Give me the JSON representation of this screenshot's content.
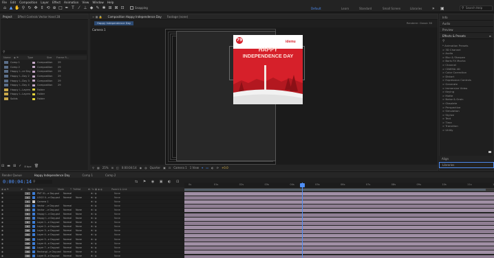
{
  "menu": [
    "File",
    "Edit",
    "Composition",
    "Layer",
    "Effect",
    "Animation",
    "View",
    "Window",
    "Help"
  ],
  "toolbar": {
    "snapping_label": "Snapping",
    "workspaces": [
      "Default",
      "Learn",
      "Standard",
      "Small Screen",
      "Libraries"
    ],
    "search_help": "Search Help"
  },
  "project_panel": {
    "tabs": [
      "Project",
      "Effect Controls  Vector Hand 28"
    ],
    "columns": [
      "Name",
      "Type",
      "Size",
      "Frame R..."
    ],
    "items": [
      {
        "name": "Comp 1",
        "type": "Composition",
        "size": "29",
        "folder": false,
        "color": "#c4a7c6"
      },
      {
        "name": "Comp 2",
        "type": "Composition",
        "size": "29",
        "folder": false,
        "color": "#c4a7c6"
      },
      {
        "name": "Happy I...ce Day",
        "type": "Composition",
        "size": "29",
        "folder": false,
        "color": "#c4a7c6"
      },
      {
        "name": "Happy I...Day 2",
        "type": "Composition",
        "size": "29",
        "folder": false,
        "color": "#c4a7c6"
      },
      {
        "name": "Happy I...Day 3",
        "type": "Composition",
        "size": "29",
        "folder": false,
        "color": "#c4a7c6"
      },
      {
        "name": "Happy I...Day 4",
        "type": "Composition",
        "size": "29",
        "folder": false,
        "color": "#c4a7c6"
      },
      {
        "name": "Happy I...Layers",
        "type": "Folder",
        "size": "",
        "folder": true,
        "color": "#e4d43a"
      },
      {
        "name": "Happy I...Layers",
        "type": "Folder",
        "size": "",
        "folder": true,
        "color": "#e4d43a"
      },
      {
        "name": "Solids",
        "type": "Folder",
        "size": "",
        "folder": true,
        "color": "#e4d43a"
      }
    ],
    "footer_bpc": "8 bpc"
  },
  "composition_panel": {
    "tabs": [
      "Composition Happy Independence Day",
      "Footage (none)"
    ],
    "subtab": "Happy Independence Day",
    "renderer": "Renderer: Classic 3D",
    "comp_label": "Camera 1"
  },
  "poster": {
    "headline_1": "HAPPY",
    "headline_2": "INDEPENDENCE DAY",
    "brand": "idemu",
    "badge": "79"
  },
  "viewer_bar": {
    "zoom": "25%",
    "timecode": "0:00:04:14",
    "resolution": "Quarter",
    "camera": "Camera 1",
    "view": "1 View",
    "offset": "+0.0"
  },
  "right_panel": {
    "items": [
      "Info",
      "Audio",
      "Preview"
    ],
    "effects_title": "Effects & Presets",
    "effects": [
      "* Animation Presets",
      "> 3D Channel",
      "> Audio",
      "> Blur & Sharpen",
      "> Boris FX Mocha",
      "> Channel",
      "> CINEMA 4D",
      "> Color Correction",
      "> Distort",
      "> Expression Controls",
      "> Generate",
      "> Immersive Video",
      "> Keying",
      "> Matte",
      "> Noise & Grain",
      "> Obsolete",
      "> Perspective",
      "> Simulation",
      "> Stylize",
      "> Text",
      "> Time",
      "> Transition",
      "> Utility"
    ],
    "bottom_items": [
      "Align",
      "Libraries"
    ]
  },
  "timeline": {
    "tabs": [
      "Render Queue",
      "Happy Independence Day",
      "Comp 1",
      "Comp 2"
    ],
    "timecode": "0:00:04:14",
    "columns": [
      "#",
      "Source Name",
      "Mode",
      "T",
      "TrkMat",
      "Parent & Link"
    ],
    "ruler": [
      "0s",
      "01s",
      "02s",
      "03s",
      "04s",
      "05s",
      "06s",
      "07s",
      "08s",
      "09s",
      "10s",
      "11s",
      "12s"
    ],
    "playhead_seconds": 4.47,
    "layers": [
      {
        "num": "1",
        "name": "PNT 01...e Day.psd",
        "mode": "Normal",
        "trkmat": "",
        "parent": "None",
        "color": "#3d7dd6"
      },
      {
        "num": "2",
        "name": "LOGO 0...e Day.psd",
        "mode": "Normal",
        "trkmat": "None",
        "parent": "None",
        "color": "#3d7dd6"
      },
      {
        "num": "3",
        "name": "Camera 1",
        "mode": "",
        "trkmat": "",
        "parent": "None",
        "color": "#c8c8c8"
      },
      {
        "num": "4",
        "name": "Vector ...e Day.psd",
        "mode": "Normal",
        "trkmat": "",
        "parent": "None",
        "color": "#3d7dd6"
      },
      {
        "num": "5",
        "name": "Vector ...e Day.psd",
        "mode": "Normal",
        "trkmat": "None",
        "parent": "None",
        "color": "#3d7dd6"
      },
      {
        "num": "6",
        "name": "Happy I...e Day.psd",
        "mode": "Normal",
        "trkmat": "None",
        "parent": "None",
        "color": "#3d7dd6"
      },
      {
        "num": "7",
        "name": "Happy I...e Day.psd",
        "mode": "Normal",
        "trkmat": "None",
        "parent": "None",
        "color": "#3d7dd6"
      },
      {
        "num": "8",
        "name": "Layer 1...e Day.psd",
        "mode": "Normal",
        "trkmat": "None",
        "parent": "None",
        "color": "#3d7dd6"
      },
      {
        "num": "9",
        "name": "Layer 2...e Day.psd",
        "mode": "Normal",
        "trkmat": "None",
        "parent": "None",
        "color": "#3d7dd6"
      },
      {
        "num": "10",
        "name": "Layer 3...e Day.psd",
        "mode": "Normal",
        "trkmat": "None",
        "parent": "None",
        "color": "#3d7dd6"
      },
      {
        "num": "11",
        "name": "Layer 4...e Day.psd",
        "mode": "Normal",
        "trkmat": "None",
        "parent": "None",
        "color": "#3d7dd6"
      },
      {
        "num": "12",
        "name": "Layer 5...e Day.psd",
        "mode": "Normal",
        "trkmat": "None",
        "parent": "None",
        "color": "#3d7dd6"
      },
      {
        "num": "13",
        "name": "Layer 6...e Day.psd",
        "mode": "Normal",
        "trkmat": "None",
        "parent": "None",
        "color": "#3d7dd6"
      },
      {
        "num": "14",
        "name": "Layer 7...e Day.psd",
        "mode": "Normal",
        "trkmat": "None",
        "parent": "None",
        "color": "#3d7dd6"
      },
      {
        "num": "15",
        "name": "Rectangl...e Day.psd",
        "mode": "Normal",
        "trkmat": "None",
        "parent": "None",
        "color": "#3d7dd6"
      },
      {
        "num": "16",
        "name": "Layer 8...e Day.psd",
        "mode": "Normal",
        "trkmat": "None",
        "parent": "None",
        "color": "#3d7dd6"
      }
    ]
  }
}
